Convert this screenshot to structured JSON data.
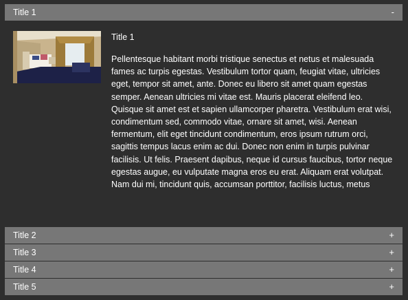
{
  "accordion": {
    "sections": [
      {
        "title": "Title 1",
        "toggle": "-",
        "expanded": true
      },
      {
        "title": "Title 2",
        "toggle": "+",
        "expanded": false
      },
      {
        "title": "Title 3",
        "toggle": "+",
        "expanded": false
      },
      {
        "title": "Title 4",
        "toggle": "+",
        "expanded": false
      },
      {
        "title": "Title 5",
        "toggle": "+",
        "expanded": false
      }
    ],
    "panel": {
      "title": "Title 1",
      "text": "Pellentesque habitant morbi tristique senectus et netus et malesuada fames ac turpis egestas. Vestibulum tortor quam, feugiat vitae, ultricies eget, tempor sit amet, ante. Donec eu libero sit amet quam egestas semper. Aenean ultricies mi vitae est. Mauris placerat eleifend leo. Quisque sit amet est et sapien ullamcorper pharetra. Vestibulum erat wisi, condimentum sed, commodo vitae, ornare sit amet, wisi. Aenean fermentum, elit eget tincidunt condimentum, eros ipsum rutrum orci, sagittis tempus lacus enim ac dui. Donec non enim in turpis pulvinar facilisis. Ut felis. Praesent dapibus, neque id cursus faucibus, tortor neque egestas augue, eu vulputate magna eros eu erat. Aliquam erat volutpat. Nam dui mi, tincidunt quis, accumsan porttitor, facilisis luctus, metus"
    }
  },
  "colors": {
    "background": "#2e2e2e",
    "header": "#777777",
    "text": "#ffffff"
  }
}
